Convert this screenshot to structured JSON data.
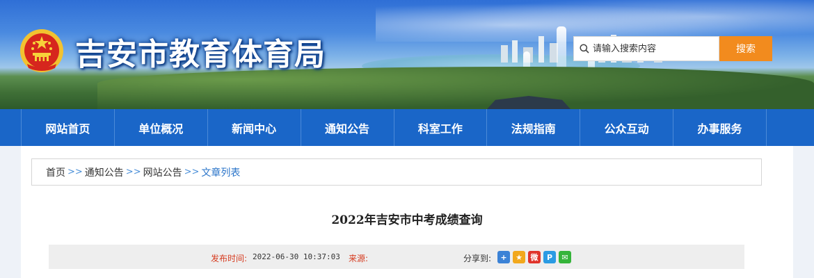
{
  "header": {
    "site_title": "吉安市教育体育局",
    "search": {
      "placeholder": "请输入搜索内容",
      "button_label": "搜索"
    }
  },
  "nav": {
    "items": [
      "网站首页",
      "单位概况",
      "新闻中心",
      "通知公告",
      "科室工作",
      "法规指南",
      "公众互动",
      "办事服务"
    ]
  },
  "breadcrumb": {
    "items": [
      "首页",
      "通知公告",
      "网站公告",
      "文章列表"
    ],
    "separator": ">>"
  },
  "article": {
    "title": "2022年吉安市中考成绩查询",
    "publish_label": "发布时间:",
    "publish_time": "2022-06-30 10:37:03",
    "source_label": "来源:",
    "share_label": "分享到:"
  },
  "share_icons": [
    {
      "name": "qzone-plus-icon",
      "color": "#3b82d6",
      "glyph": "+"
    },
    {
      "name": "qzone-star-icon",
      "color": "#f2a81c",
      "glyph": "★"
    },
    {
      "name": "weibo-icon",
      "color": "#e0332b",
      "glyph": "微"
    },
    {
      "name": "tencent-weibo-icon",
      "color": "#2b9be3",
      "glyph": "P"
    },
    {
      "name": "wechat-icon",
      "color": "#35b43a",
      "glyph": "✉"
    }
  ],
  "colors": {
    "nav_bg": "#1a66c8",
    "search_button": "#f28b1e",
    "breadcrumb_link": "#2a74c9",
    "meta_label": "#d63b1f"
  }
}
